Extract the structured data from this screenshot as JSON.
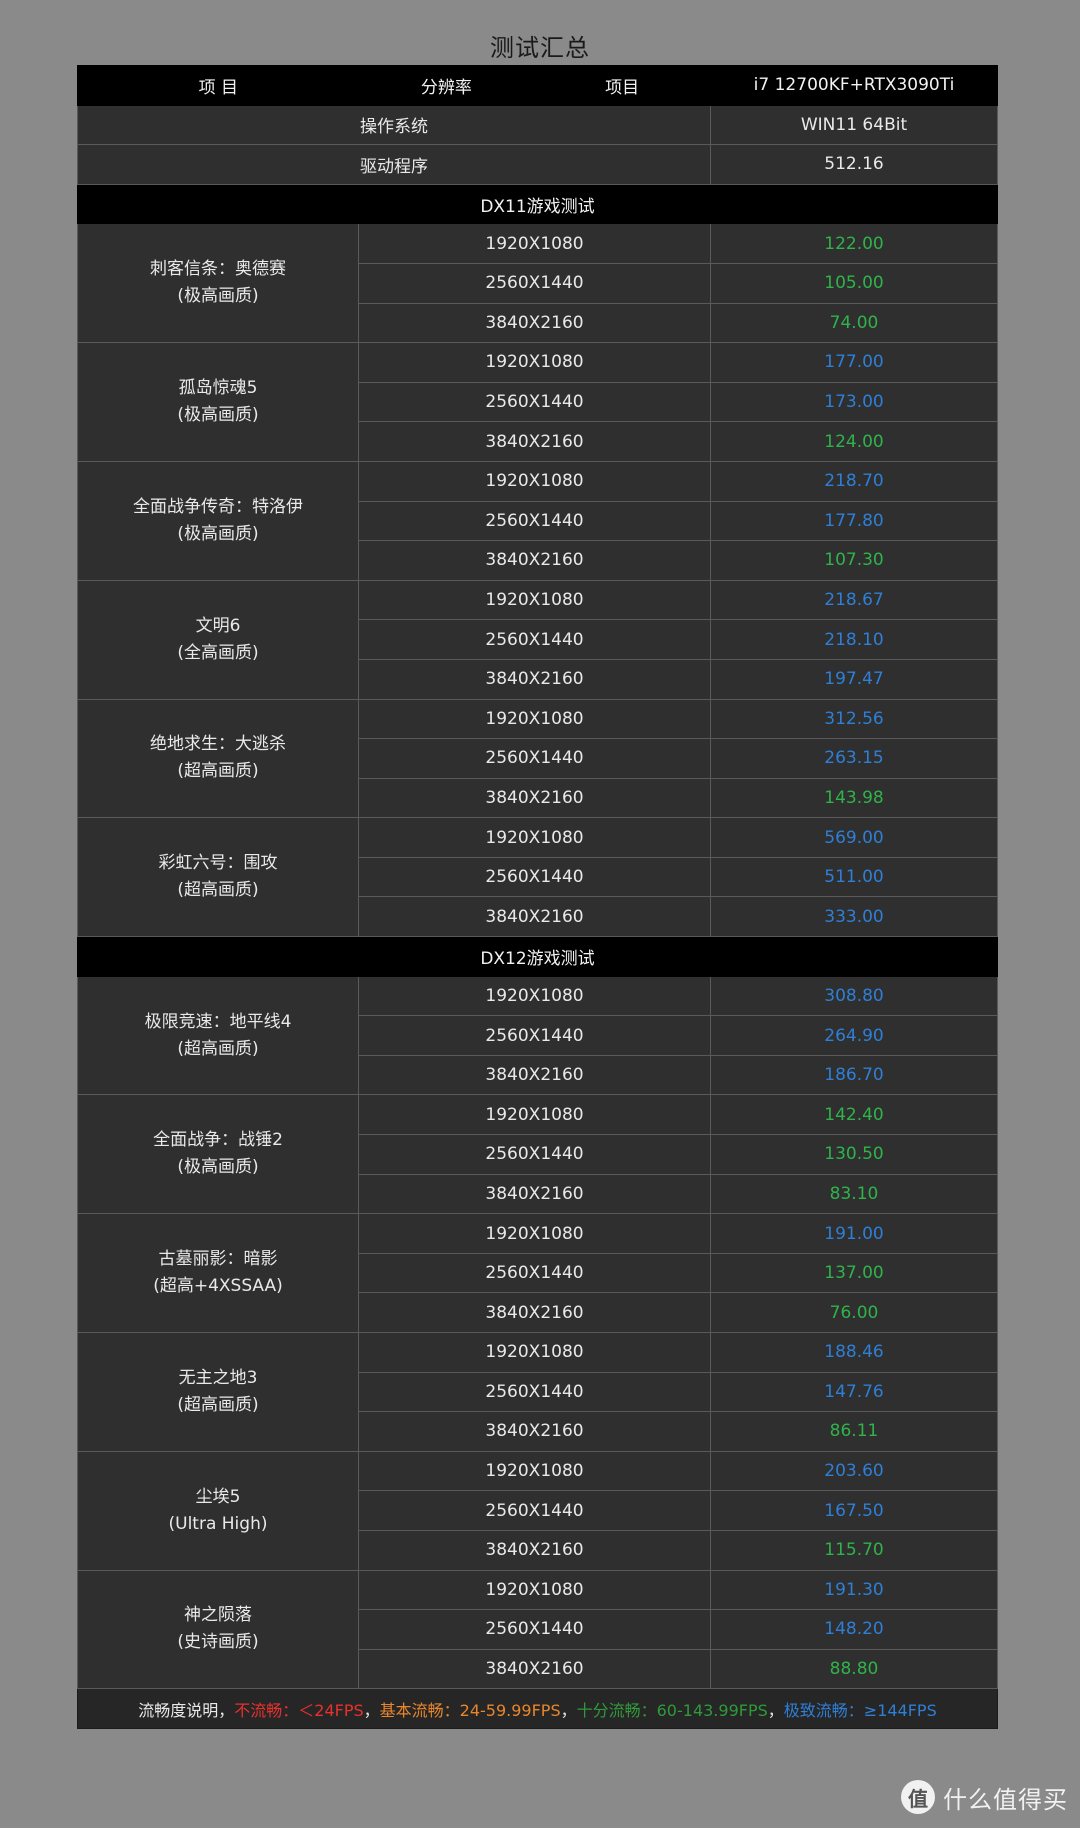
{
  "title": "测试汇总",
  "header": {
    "col_item": "项    目",
    "col_resolution": "分辨率",
    "col_item2": "项目",
    "col_config": "i7 12700KF+RTX3090Ti"
  },
  "os_row": {
    "label": "操作系统",
    "value": "WIN11 64Bit"
  },
  "driver_row": {
    "label": "驱动程序",
    "value": "512.16"
  },
  "sections": [
    {
      "title": "DX11游戏测试",
      "games": [
        {
          "name": "刺客信条：奥德赛",
          "quality": "(极高画质)",
          "rows": [
            {
              "res": "1920X1080",
              "fps": "122.00",
              "color": "green"
            },
            {
              "res": "2560X1440",
              "fps": "105.00",
              "color": "green"
            },
            {
              "res": "3840X2160",
              "fps": "74.00",
              "color": "green"
            }
          ]
        },
        {
          "name": "孤岛惊魂5",
          "quality": "(极高画质)",
          "rows": [
            {
              "res": "1920X1080",
              "fps": "177.00",
              "color": "blue"
            },
            {
              "res": "2560X1440",
              "fps": "173.00",
              "color": "blue"
            },
            {
              "res": "3840X2160",
              "fps": "124.00",
              "color": "green"
            }
          ]
        },
        {
          "name": "全面战争传奇：特洛伊",
          "quality": "(极高画质)",
          "rows": [
            {
              "res": "1920X1080",
              "fps": "218.70",
              "color": "blue"
            },
            {
              "res": "2560X1440",
              "fps": "177.80",
              "color": "blue"
            },
            {
              "res": "3840X2160",
              "fps": "107.30",
              "color": "green"
            }
          ]
        },
        {
          "name": "文明6",
          "quality": "(全高画质)",
          "rows": [
            {
              "res": "1920X1080",
              "fps": "218.67",
              "color": "blue"
            },
            {
              "res": "2560X1440",
              "fps": "218.10",
              "color": "blue"
            },
            {
              "res": "3840X2160",
              "fps": "197.47",
              "color": "blue"
            }
          ]
        },
        {
          "name": "绝地求生：大逃杀",
          "quality": "(超高画质)",
          "rows": [
            {
              "res": "1920X1080",
              "fps": "312.56",
              "color": "blue"
            },
            {
              "res": "2560X1440",
              "fps": "263.15",
              "color": "blue"
            },
            {
              "res": "3840X2160",
              "fps": "143.98",
              "color": "green"
            }
          ]
        },
        {
          "name": "彩虹六号：围攻",
          "quality": "(超高画质)",
          "rows": [
            {
              "res": "1920X1080",
              "fps": "569.00",
              "color": "blue"
            },
            {
              "res": "2560X1440",
              "fps": "511.00",
              "color": "blue"
            },
            {
              "res": "3840X2160",
              "fps": "333.00",
              "color": "blue"
            }
          ]
        }
      ]
    },
    {
      "title": "DX12游戏测试",
      "games": [
        {
          "name": "极限竞速：地平线4",
          "quality": "(超高画质)",
          "rows": [
            {
              "res": "1920X1080",
              "fps": "308.80",
              "color": "blue"
            },
            {
              "res": "2560X1440",
              "fps": "264.90",
              "color": "blue"
            },
            {
              "res": "3840X2160",
              "fps": "186.70",
              "color": "blue"
            }
          ]
        },
        {
          "name": "全面战争：战锤2",
          "quality": "(极高画质)",
          "rows": [
            {
              "res": "1920X1080",
              "fps": "142.40",
              "color": "green"
            },
            {
              "res": "2560X1440",
              "fps": "130.50",
              "color": "green"
            },
            {
              "res": "3840X2160",
              "fps": "83.10",
              "color": "green"
            }
          ]
        },
        {
          "name": "古墓丽影：暗影",
          "quality": "(超高+4XSSAA)",
          "rows": [
            {
              "res": "1920X1080",
              "fps": "191.00",
              "color": "blue"
            },
            {
              "res": "2560X1440",
              "fps": "137.00",
              "color": "green"
            },
            {
              "res": "3840X2160",
              "fps": "76.00",
              "color": "green"
            }
          ]
        },
        {
          "name": "无主之地3",
          "quality": "(超高画质)",
          "rows": [
            {
              "res": "1920X1080",
              "fps": "188.46",
              "color": "blue"
            },
            {
              "res": "2560X1440",
              "fps": "147.76",
              "color": "blue"
            },
            {
              "res": "3840X2160",
              "fps": "86.11",
              "color": "green"
            }
          ]
        },
        {
          "name": "尘埃5",
          "quality": "(Ultra High)",
          "rows": [
            {
              "res": "1920X1080",
              "fps": "203.60",
              "color": "blue"
            },
            {
              "res": "2560X1440",
              "fps": "167.50",
              "color": "blue"
            },
            {
              "res": "3840X2160",
              "fps": "115.70",
              "color": "green"
            }
          ]
        },
        {
          "name": "神之陨落",
          "quality": "(史诗画质)",
          "rows": [
            {
              "res": "1920X1080",
              "fps": "191.30",
              "color": "blue"
            },
            {
              "res": "2560X1440",
              "fps": "148.20",
              "color": "blue"
            },
            {
              "res": "3840X2160",
              "fps": "88.80",
              "color": "green"
            }
          ]
        }
      ]
    }
  ],
  "legend": {
    "intro": "流畅度说明，",
    "not_smooth": "不流畅：＜24FPS",
    "sep1": "，",
    "basic": "基本流畅：24-59.99FPS",
    "sep2": "，",
    "very": "十分流畅：60-143.99FPS",
    "sep3": "，",
    "extreme": "极致流畅：≥144FPS"
  },
  "colors": {
    "green": "#2fb34a",
    "blue": "#2f7fd6",
    "red": "#e8312d",
    "orange": "#e8862b",
    "background": "#8a8a8a",
    "cell": "#2f2f2f",
    "header": "#000000"
  },
  "watermark": {
    "logo": "值",
    "text": "什么值得买"
  }
}
